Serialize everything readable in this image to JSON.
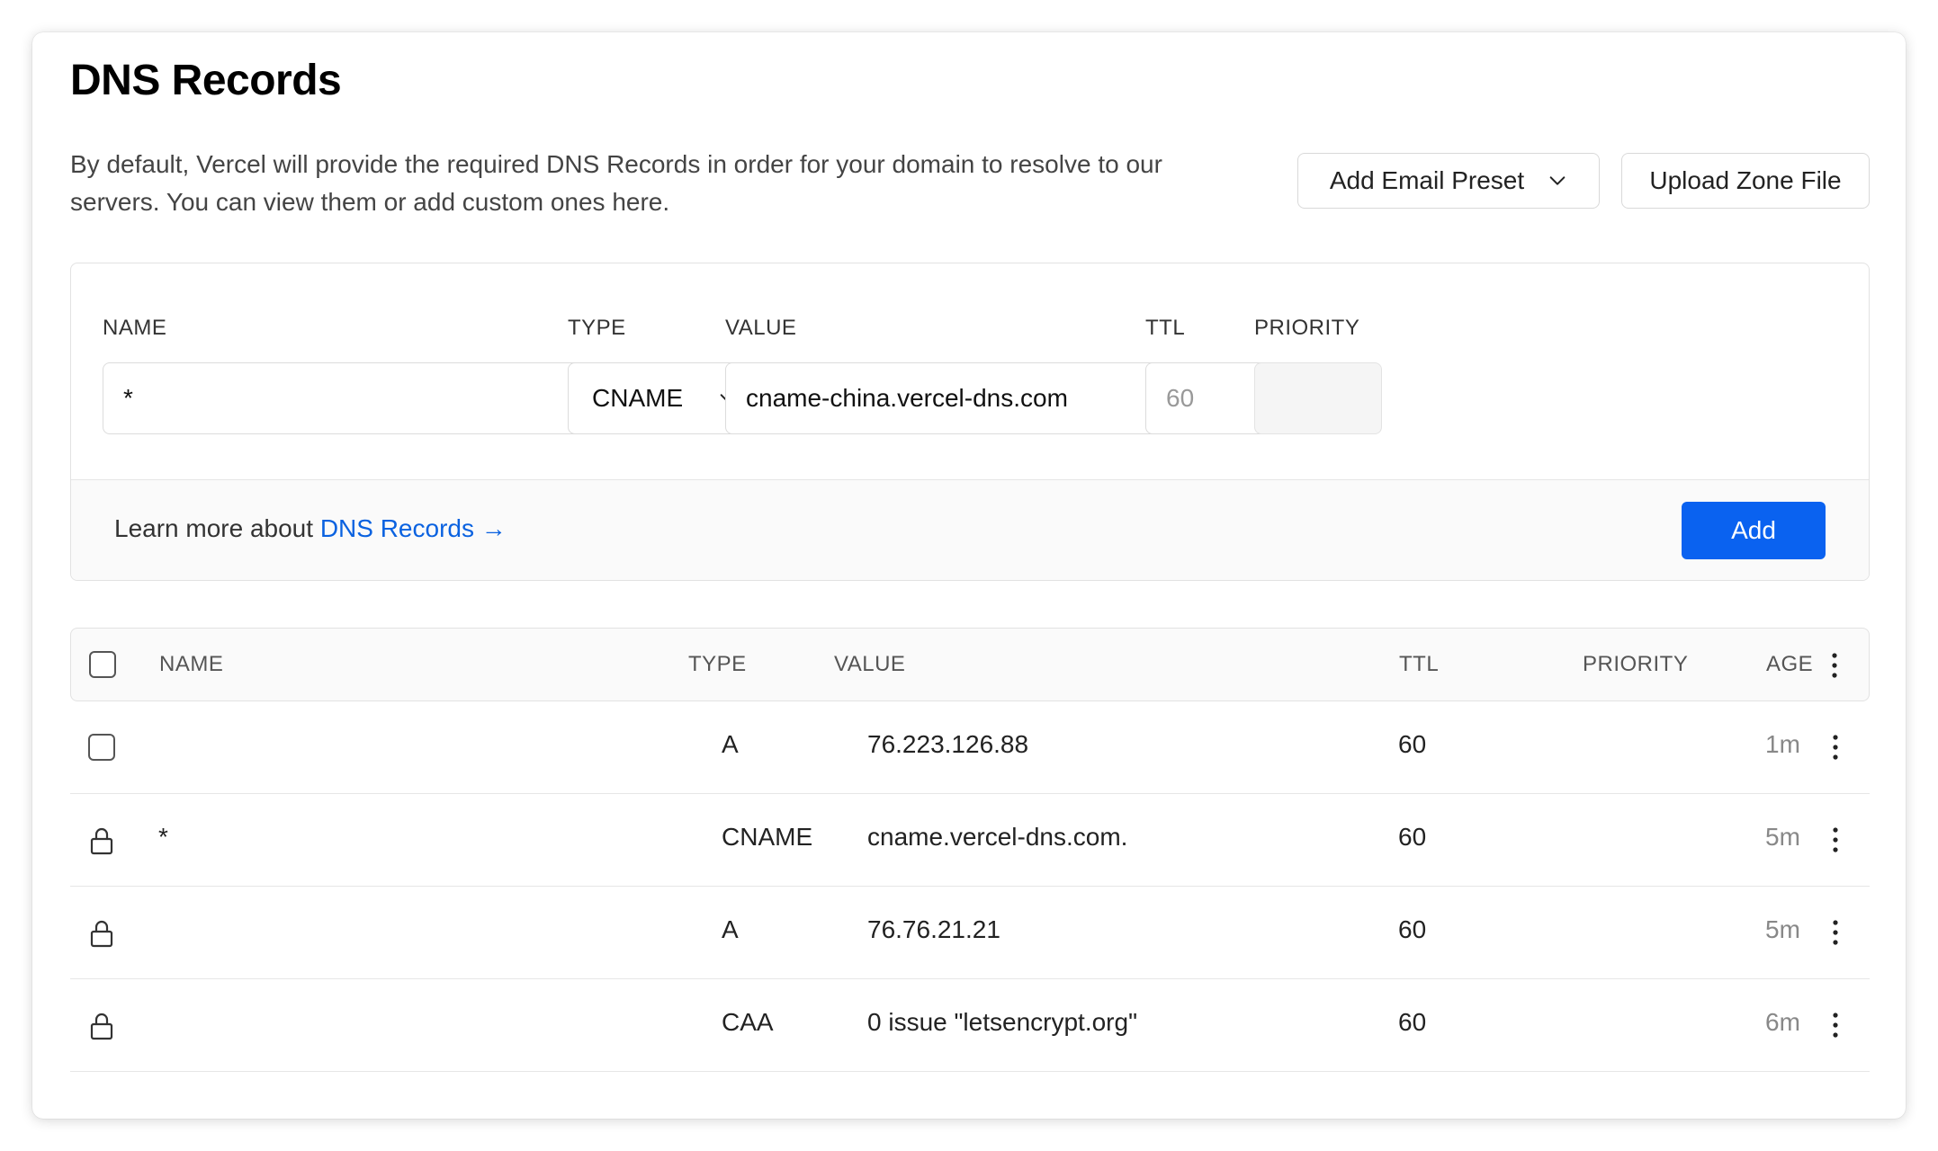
{
  "header": {
    "title": "DNS Records",
    "description": "By default, Vercel will provide the required DNS Records in order for your domain to resolve to our servers. You can view them or add custom ones here.",
    "email_preset_label": "Add Email Preset",
    "upload_zone_label": "Upload Zone File"
  },
  "form": {
    "labels": {
      "name": "NAME",
      "type": "TYPE",
      "value": "VALUE",
      "ttl": "TTL",
      "priority": "PRIORITY"
    },
    "name_value": "*",
    "type_value": "CNAME",
    "value_value": "cname-china.vercel-dns.com",
    "ttl_placeholder": "60",
    "priority_value": "",
    "learn_prefix": "Learn more about ",
    "learn_link": "DNS Records →",
    "add_label": "Add"
  },
  "table": {
    "headers": {
      "name": "NAME",
      "type": "TYPE",
      "value": "VALUE",
      "ttl": "TTL",
      "priority": "PRIORITY",
      "age": "AGE"
    },
    "rows": [
      {
        "name": "",
        "type": "A",
        "value": "76.223.126.88",
        "ttl": "60",
        "priority": "",
        "age": "1m",
        "locked": false
      },
      {
        "name": "*",
        "type": "CNAME",
        "value": "cname.vercel-dns.com.",
        "ttl": "60",
        "priority": "",
        "age": "5m",
        "locked": true
      },
      {
        "name": "",
        "type": "A",
        "value": "76.76.21.21",
        "ttl": "60",
        "priority": "",
        "age": "5m",
        "locked": true
      },
      {
        "name": "",
        "type": "CAA",
        "value": "0 issue \"letsencrypt.org\"",
        "ttl": "60",
        "priority": "",
        "age": "6m",
        "locked": true
      }
    ]
  },
  "icons": {
    "dropdown": "chevron-down-icon",
    "lock": "lock-icon",
    "menu": "more-vertical-icon"
  },
  "colors": {
    "accent": "#0a62f0",
    "link": "#0a62e0"
  }
}
